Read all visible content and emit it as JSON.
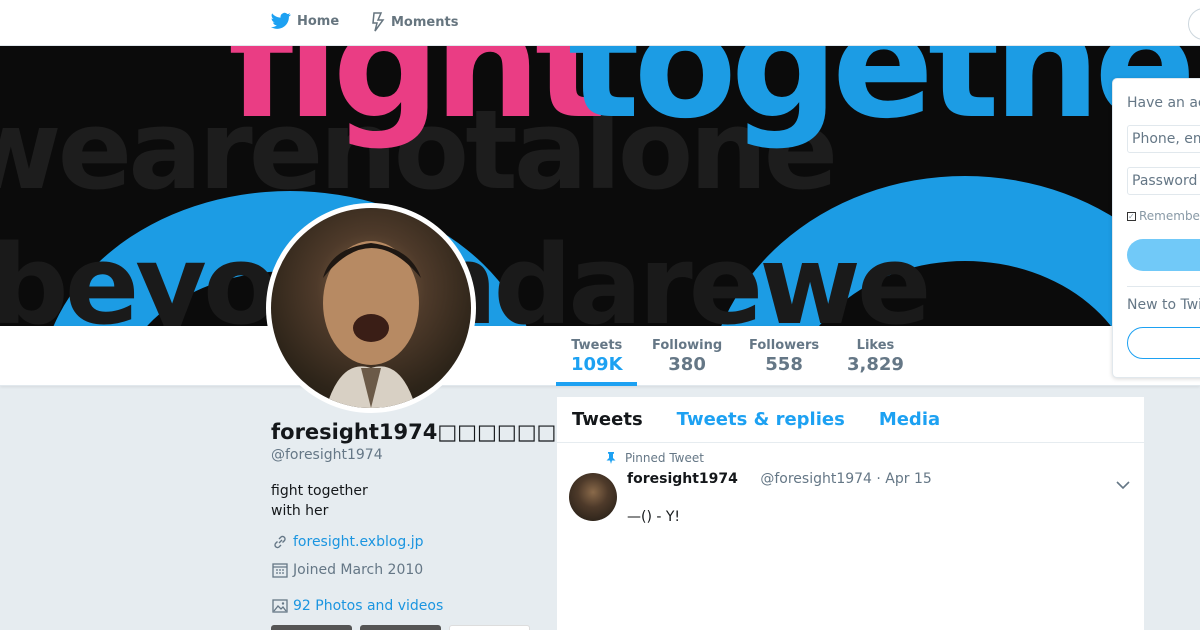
{
  "nav": {
    "home_label": "Home",
    "moments_label": "Moments",
    "icons": [
      "twitter-bird-icon",
      "lightning-bolt-icon"
    ]
  },
  "banner": {
    "text_fight": "fight",
    "text_together": "together"
  },
  "stats": [
    {
      "label": "Tweets",
      "value": "109K"
    },
    {
      "label": "Following",
      "value": "380"
    },
    {
      "label": "Followers",
      "value": "558"
    },
    {
      "label": "Likes",
      "value": "3,829"
    }
  ],
  "profile": {
    "name": "foresight1974□□□□□□□",
    "handle": "@foresight1974",
    "bio_line1": "fight together",
    "bio_line2": "with her",
    "website": "foresight.exblog.jp",
    "joined": "Joined March 2010",
    "photos": "92 Photos and videos"
  },
  "timeline": {
    "tabs": [
      "Tweets",
      "Tweets & replies",
      "Media"
    ],
    "tweet": {
      "pinned_label": "Pinned Tweet",
      "name": "foresight1974",
      "meta": "@foresight1974 · Apr 15",
      "text": "—() - Y!"
    }
  },
  "login": {
    "title": "Have an ac",
    "phone_placeholder": "Phone, em",
    "password_placeholder": "Password",
    "remember": "Remembe",
    "new_to": "New to Twi"
  },
  "colors": {
    "accent": "#1da1f2",
    "link": "#1b95e0",
    "banner_pink": "#ea3d84",
    "banner_blue": "#1c9ce4"
  }
}
